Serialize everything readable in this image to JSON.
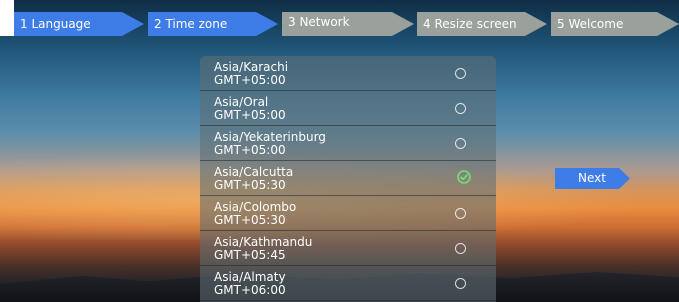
{
  "steps": [
    {
      "label": "1  Language",
      "state": "done"
    },
    {
      "label": "2  Time zone",
      "state": "current"
    },
    {
      "label": "3  Network",
      "state": "upcoming"
    },
    {
      "label": "4  Resize screen",
      "state": "upcoming"
    },
    {
      "label": "5  Welcome",
      "state": "upcoming"
    }
  ],
  "timezones": [
    {
      "name": "Asia/Karachi",
      "offset": "GMT+05:00",
      "selected": false
    },
    {
      "name": "Asia/Oral",
      "offset": "GMT+05:00",
      "selected": false
    },
    {
      "name": "Asia/Yekaterinburg",
      "offset": "GMT+05:00",
      "selected": false
    },
    {
      "name": "Asia/Calcutta",
      "offset": "GMT+05:30",
      "selected": true
    },
    {
      "name": "Asia/Colombo",
      "offset": "GMT+05:30",
      "selected": false
    },
    {
      "name": "Asia/Kathmandu",
      "offset": "GMT+05:45",
      "selected": false
    },
    {
      "name": "Asia/Almaty",
      "offset": "GMT+06:00",
      "selected": false
    }
  ],
  "next_button": {
    "label": "Next"
  },
  "icons": {
    "selected": "check-circle-icon",
    "unselected": "radio-empty-icon"
  },
  "colors": {
    "accent": "#3e7de8",
    "step_inactive": "#9aa09b",
    "check": "#6fe07a"
  }
}
